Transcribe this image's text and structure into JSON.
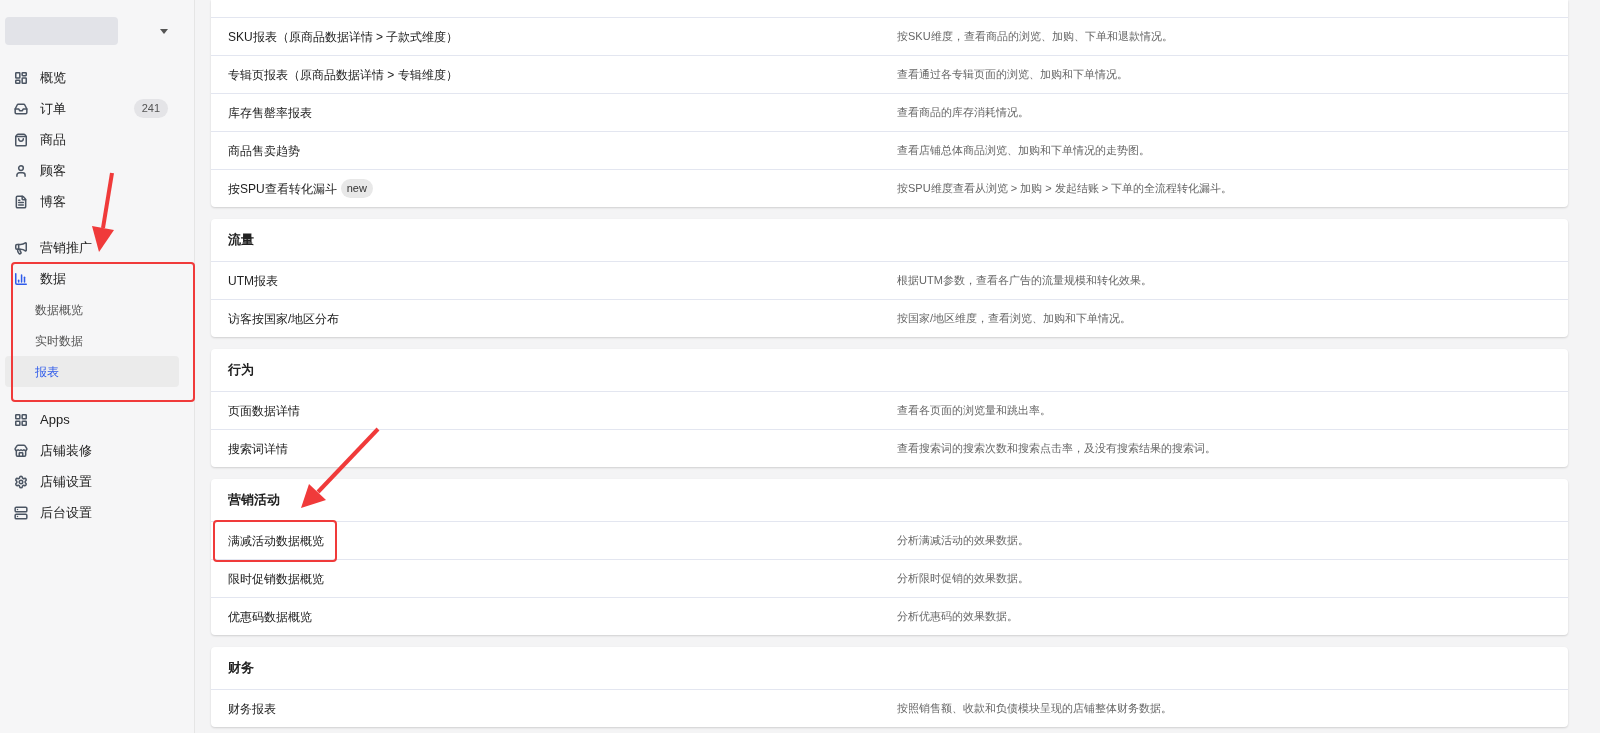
{
  "sidebar": {
    "store_switcher": {
      "expanded": false
    },
    "nav_groups": [
      {
        "items": [
          {
            "label": "概览",
            "selected": false
          },
          {
            "label": "订单",
            "badge": "241",
            "selected": false
          },
          {
            "label": "商品",
            "selected": false
          },
          {
            "label": "顾客",
            "selected": false
          },
          {
            "label": "博客",
            "selected": false
          }
        ]
      },
      {
        "items": [
          {
            "label": "营销推广",
            "selected": false
          },
          {
            "label": "数据",
            "selected": false,
            "expanded": true,
            "children": [
              {
                "label": "数据概览",
                "selected": false
              },
              {
                "label": "实时数据",
                "selected": false
              },
              {
                "label": "报表",
                "selected": true
              }
            ]
          },
          {
            "label": "Apps",
            "selected": false
          },
          {
            "label": "店铺装修",
            "selected": false
          },
          {
            "label": "店铺设置",
            "selected": false
          },
          {
            "label": "后台设置",
            "selected": false
          }
        ]
      }
    ]
  },
  "report_groups": [
    {
      "rows": [
        {
          "name": "SKU报表（原商品数据详情 > 子款式维度）",
          "description": "按SKU维度，查看商品的浏览、加购、下单和退款情况。"
        },
        {
          "name": "专辑页报表（原商品数据详情 > 专辑维度）",
          "description": "查看通过各专辑页面的浏览、加购和下单情况。"
        },
        {
          "name": "库存售罄率报表",
          "description": "查看商品的库存消耗情况。"
        },
        {
          "name": "商品售卖趋势",
          "description": "查看店铺总体商品浏览、加购和下单情况的走势图。"
        },
        {
          "name": "按SPU查看转化漏斗",
          "badge": "new",
          "description": "按SPU维度查看从浏览 > 加购 > 发起结账 > 下单的全流程转化漏斗。"
        }
      ]
    },
    {
      "title": "流量",
      "rows": [
        {
          "name": "UTM报表",
          "description": "根据UTM参数，查看各广告的流量规模和转化效果。"
        },
        {
          "name": "访客按国家/地区分布",
          "description": "按国家/地区维度，查看浏览、加购和下单情况。"
        }
      ]
    },
    {
      "title": "行为",
      "rows": [
        {
          "name": "页面数据详情",
          "description": "查看各页面的浏览量和跳出率。"
        },
        {
          "name": "搜索词详情",
          "description": "查看搜索词的搜索次数和搜索点击率，及没有搜索结果的搜索词。"
        }
      ]
    },
    {
      "title": "营销活动",
      "rows": [
        {
          "name": "满减活动数据概览",
          "description": "分析满减活动的效果数据。"
        },
        {
          "name": "限时促销数据概览",
          "description": "分析限时促销的效果数据。"
        },
        {
          "name": "优惠码数据概览",
          "description": "分析优惠码的效果数据。"
        }
      ]
    },
    {
      "title": "财务",
      "rows": [
        {
          "name": "财务报表",
          "description": "按照销售额、收款和负债模块呈现的店铺整体财务数据。"
        }
      ]
    }
  ]
}
